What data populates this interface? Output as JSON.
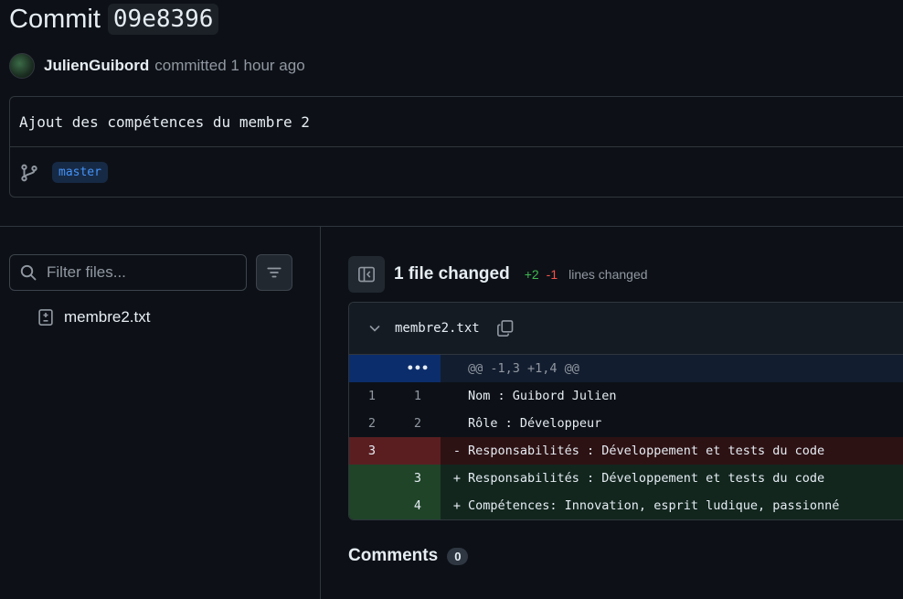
{
  "header": {
    "title": "Commit",
    "sha": "09e8396",
    "author": "JulienGuibord",
    "meta": "committed 1 hour ago"
  },
  "commit": {
    "message": "Ajout des compétences du membre 2",
    "branch": "master"
  },
  "sidebar": {
    "filter_placeholder": "Filter files...",
    "files": [
      {
        "name": "membre2.txt",
        "icon": "file-diff-icon"
      }
    ]
  },
  "summary": {
    "files_changed": "1 file changed",
    "additions": "+2",
    "deletions": "-1",
    "lines_label": "lines changed"
  },
  "diff": {
    "filename": "membre2.txt",
    "expand": "•••",
    "hunk": "@@ -1,3 +1,4 @@",
    "rows": [
      {
        "type": "ctx",
        "old": "1",
        "new": "1",
        "sign": "",
        "text": "Nom : Guibord Julien"
      },
      {
        "type": "ctx",
        "old": "2",
        "new": "2",
        "sign": "",
        "text": "Rôle : Développeur"
      },
      {
        "type": "del",
        "old": "3",
        "new": "",
        "sign": "-",
        "text": "Responsabilités : Développement et tests du code"
      },
      {
        "type": "add",
        "old": "",
        "new": "3",
        "sign": "+",
        "text": "Responsabilités : Développement et tests du code"
      },
      {
        "type": "add",
        "old": "",
        "new": "4",
        "sign": "+",
        "text": "Compétences: Innovation, esprit ludique, passionné"
      }
    ]
  },
  "comments": {
    "label": "Comments",
    "count": "0"
  },
  "colors": {
    "background": "#0d1117",
    "border": "#30363d",
    "addition": "#3fb950",
    "deletion": "#f85149",
    "branch": "#4493f8"
  }
}
